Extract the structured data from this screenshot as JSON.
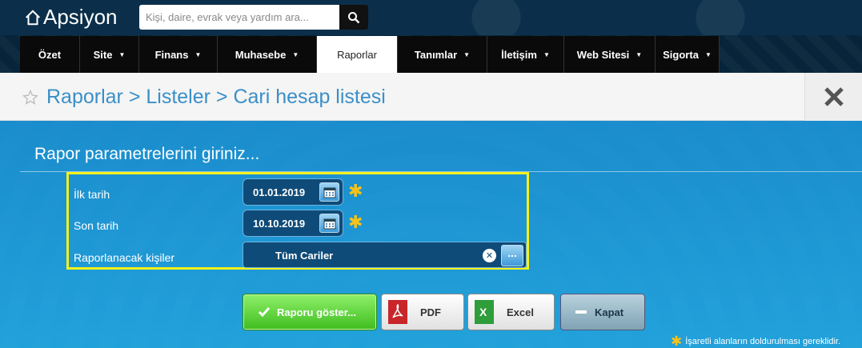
{
  "app": {
    "name": "Apsiyon"
  },
  "search": {
    "placeholder": "Kişi, daire, evrak veya yardım ara..."
  },
  "nav": {
    "items": [
      {
        "label": "Özet",
        "caret": false
      },
      {
        "label": "Site",
        "caret": true
      },
      {
        "label": "Finans",
        "caret": true
      },
      {
        "label": "Muhasebe",
        "caret": true
      },
      {
        "label": "Raporlar",
        "caret": false,
        "active": true
      },
      {
        "label": "Tanımlar",
        "caret": true
      },
      {
        "label": "İletişim",
        "caret": true
      },
      {
        "label": "Web Sitesi",
        "caret": true
      },
      {
        "label": "Sigorta",
        "caret": true
      }
    ]
  },
  "header": {
    "breadcrumb": "Raporlar > Listeler > Cari hesap listesi"
  },
  "form": {
    "title": "Rapor parametrelerini giriniz...",
    "start_label": "İlk tarih",
    "start_value": "01.01.2019",
    "end_label": "Son tarih",
    "end_value": "10.10.2019",
    "persons_label": "Raporlanacak kişiler",
    "persons_value": "Tüm Cariler",
    "browse": "..."
  },
  "buttons": {
    "show": "Raporu göster...",
    "pdf": "PDF",
    "excel": "Excel",
    "close": "Kapat"
  },
  "note": "İşaretli alanların doldurulması gereklidir.",
  "colors": {
    "accent": "#1c8fd0",
    "required": "#f7c21a",
    "highlight": "#f7f11a"
  }
}
